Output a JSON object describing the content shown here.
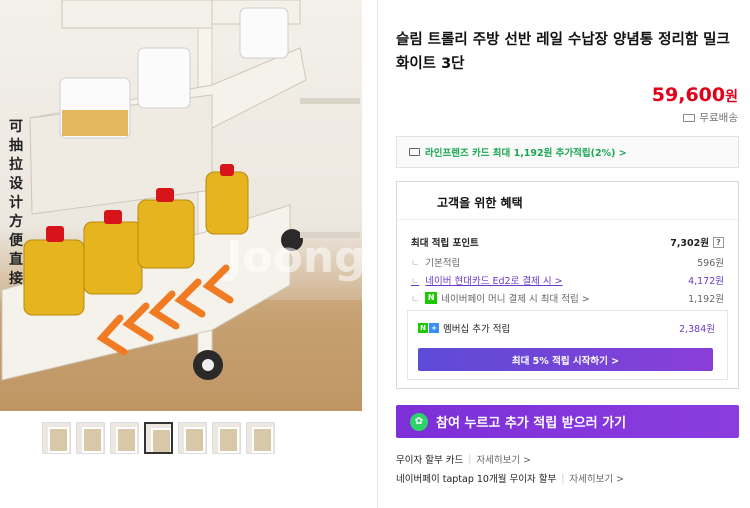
{
  "image": {
    "vertical_caption": "可抽拉设计 方便直接",
    "watermark": "Joong"
  },
  "thumbnails": 7,
  "product": {
    "title": "슬림 트롤리 주방 선반 레일 수납장 양념통 정리함 밀크화이트 3단",
    "price": "59,600",
    "price_unit": "원",
    "shipping": "무료배송"
  },
  "card_banner": "라인프렌즈 카드 최대 1,192원 추가적립(2%) >",
  "benefit": {
    "heading": "고객을 위한 혜택",
    "max_points_label": "최대 적립 포인트",
    "max_points_value": "7,302원",
    "help": "?",
    "rows": [
      {
        "label": "기본적립",
        "value": "596원"
      },
      {
        "label": "네이버 현대카드 Ed2로 결제 시 >",
        "value": "4,172원"
      },
      {
        "label": "네이버페이 머니 결제 시 최대 적립 >",
        "value": "1,192원"
      }
    ],
    "npay_badge": "N",
    "membership_label": "멤버십 추가 적립",
    "membership_value": "2,384원",
    "membership_button": "최대 5% 적립 시작하기 >"
  },
  "cta": "참여 누르고 추가 적립 받으러 가기",
  "installment": {
    "label": "무이자 할부 카드",
    "more": "자세히보기 >"
  },
  "taptap": {
    "label": "네이버페이 taptap 10개월 무이자 할부",
    "more": "자세히보기 >"
  },
  "colors": {
    "price": "#e0001a",
    "green": "#1aa752",
    "purple": "#7d2fd8",
    "link": "#6a3cc9"
  }
}
